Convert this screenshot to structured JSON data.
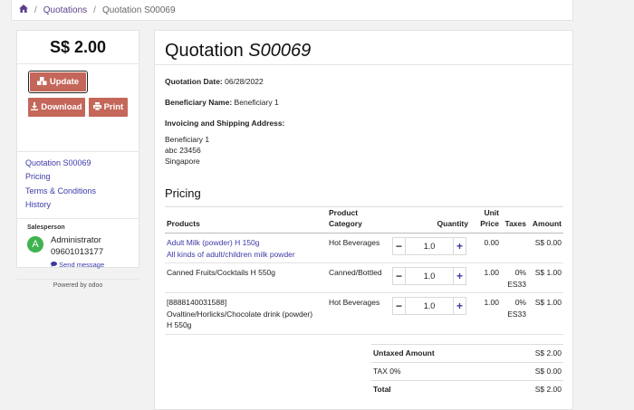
{
  "breadcrumb": {
    "home_icon": "home-icon",
    "quotations": "Quotations",
    "current": "Quotation S00069"
  },
  "sidebar": {
    "total": "S$ 2.00",
    "update_label": "Update",
    "download_label": "Download",
    "print_label": "Print",
    "nav": [
      "Quotation S00069",
      "Pricing",
      "Terms & Conditions",
      "History"
    ],
    "salesperson_label": "Salesperson",
    "avatar_letter": "A",
    "salesperson_name": "Administrator",
    "salesperson_phone": "09601013177",
    "send_message": "Send message",
    "powered_by": "Powered by odoo"
  },
  "main": {
    "title_prefix": "Quotation ",
    "title_number": "S00069",
    "date_label": "Quotation Date:",
    "date_value": "06/28/2022",
    "beneficiary_label": "Beneficiary Name:",
    "beneficiary_value": "Beneficiary 1",
    "address_label": "Invoicing and Shipping Address:",
    "address_lines": [
      "Beneficiary 1",
      "abc 23456",
      "Singapore"
    ],
    "pricing_heading": "Pricing",
    "columns": {
      "products": "Products",
      "category_1": "Product",
      "category_2": "Category",
      "quantity": "Quantity",
      "unit_1": "Unit",
      "unit_2": "Price",
      "taxes": "Taxes",
      "amount": "Amount"
    },
    "lines": [
      {
        "name_1": "Adult Milk (powder) H 150g",
        "name_2": "All kinds of adult/children milk powder",
        "name_3": "",
        "category": "Hot Beverages",
        "qty": "1.0",
        "unit_price": "0.00",
        "tax_1": "",
        "tax_2": "",
        "amount": "S$ 0.00"
      },
      {
        "name_1": "Canned Fruits/Cocktails H 550g",
        "name_2": "",
        "name_3": "",
        "category": "Canned/Bottled",
        "qty": "1.0",
        "unit_price": "1.00",
        "tax_1": "0%",
        "tax_2": "ES33",
        "amount": "S$ 1.00"
      },
      {
        "name_1": "[8888140031588]",
        "name_2": "Ovaltine/Horlicks/Chocolate drink (powder)",
        "name_3": "H 550g",
        "category": "Hot Beverages",
        "qty": "1.0",
        "unit_price": "1.00",
        "tax_1": "0%",
        "tax_2": "ES33",
        "amount": "S$ 1.00"
      }
    ],
    "totals": [
      {
        "label": "Untaxed Amount",
        "value": "S$ 2.00"
      },
      {
        "label": "TAX 0%",
        "value": "S$ 0.00"
      },
      {
        "label": "Total",
        "value": "S$ 2.00"
      }
    ]
  },
  "colors": {
    "accent": "#c4675a",
    "link": "#3d3aa8",
    "avatar": "#3fb34f"
  }
}
